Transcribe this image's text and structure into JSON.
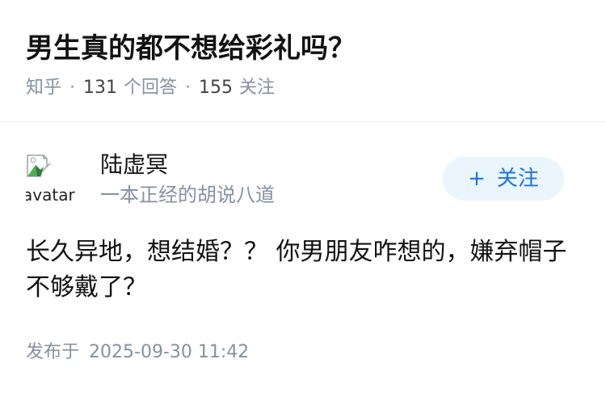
{
  "question": {
    "title": "男生真的都不想给彩礼吗？",
    "site": "知乎",
    "separator": "·",
    "answer_count": "131",
    "answer_label": "个回答",
    "follower_count": "155",
    "follower_label": "关注"
  },
  "author": {
    "avatar_alt": "avatar",
    "name": "陆虚冥",
    "bio": "一本正经的胡说八道",
    "follow_plus": "+",
    "follow_label": "关注"
  },
  "answer": {
    "content": "长久异地，想结婚？？ 你男朋友咋想的，嫌弃帽子不够戴了？",
    "published_label": "发布于",
    "published_time": "2025-09-30 11:42"
  },
  "colors": {
    "title": "#121212",
    "meta": "#8590a6",
    "follow_bg": "#ebf5fd",
    "follow_text": "#1772f6"
  },
  "icons": {
    "avatar": "broken-image-icon",
    "follow": "plus-icon"
  }
}
